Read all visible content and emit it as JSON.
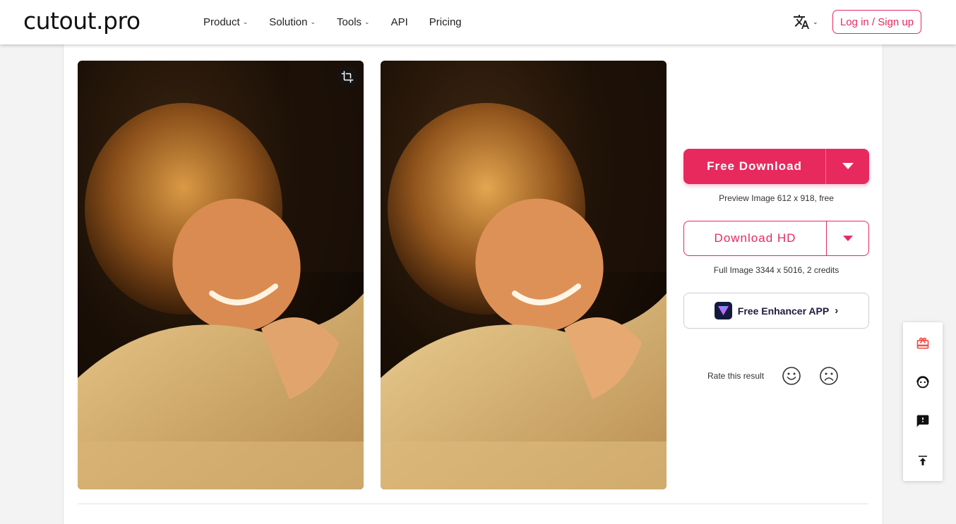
{
  "header": {
    "logo": "cutout.pro",
    "nav": [
      {
        "label": "Product",
        "has_dropdown": true
      },
      {
        "label": "Solution",
        "has_dropdown": true
      },
      {
        "label": "Tools",
        "has_dropdown": true
      },
      {
        "label": "API",
        "has_dropdown": false
      },
      {
        "label": "Pricing",
        "has_dropdown": false
      }
    ],
    "language_icon": "translate-icon",
    "login_label": "Log in / Sign up"
  },
  "panel": {
    "free_download_label": "Free Download",
    "free_caption": "Preview Image 612 x 918, free",
    "download_hd_label": "Download HD",
    "hd_caption": "Full Image 3344 x 5016, 2 credits",
    "app_label": "Free Enhancer APP",
    "rate_label": "Rate this result"
  },
  "icons": {
    "crop": "crop-icon",
    "gift": "gift-icon",
    "support": "support-agent-icon",
    "feedback": "feedback-icon",
    "top": "back-to-top-icon"
  },
  "colors": {
    "accent": "#e8295e",
    "text": "#222222",
    "app_brand": "#141a3c"
  }
}
